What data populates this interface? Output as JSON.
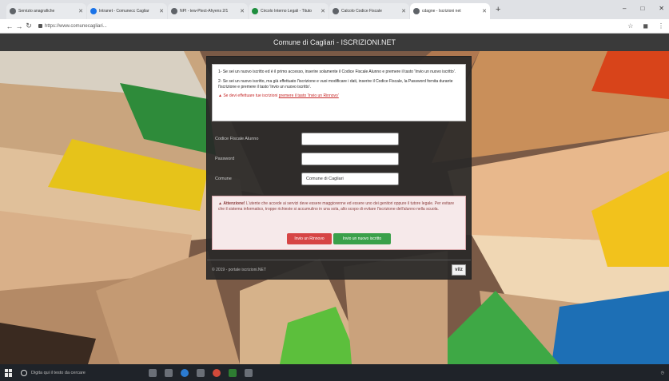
{
  "browser": {
    "tabs": [
      {
        "label": "Servizio anagrafiche",
        "favicon": "globe-icon"
      },
      {
        "label": "Intranet - Comunecc Cagliar",
        "favicon": "globe-icon"
      },
      {
        "label": "NPI - tew-Ptect-Ahyens 2/1",
        "favicon": "globe-icon"
      },
      {
        "label": "Circolo Interno Legali - Tituto",
        "favicon": "sheet-icon"
      },
      {
        "label": "Calcolo Codice Fiscale",
        "favicon": "globe-icon"
      },
      {
        "label": "cdagne - Iscrizioni net",
        "favicon": "globe-icon",
        "active": true
      }
    ],
    "new_tab": "+",
    "window_controls": [
      "–",
      "□",
      "✕"
    ],
    "url": "https://www.comunecagliari..."
  },
  "app": {
    "title": "Comune di Cagliari - ISCRIZIONI.NET"
  },
  "notice": {
    "line1": "1- Se sei un nuovo iscritto ed è il primo accesso, inserire solamente il Codice Fiscale Alunno e premere il tasto 'Invio un nuovo iscritto'.",
    "line2": "2- Se sei un nuovo iscritto, ma già effettuato l'iscrizione e vuoi modificare i dati, inserire il Codice Fiscale, la Password fornita durante l'iscrizione e premere il tasto 'Invio un nuovo iscritto'.",
    "line3_prefix": "Se devi effettuare tue iscrizioni",
    "line3_link": "premere il tasto 'Invio un Rinnovo'"
  },
  "form": {
    "fields": [
      {
        "label": "Codice Fiscale Alunno",
        "value": ""
      },
      {
        "label": "Password",
        "value": ""
      },
      {
        "label": "Comune",
        "value": "Comune di Cagliari"
      }
    ]
  },
  "alert": {
    "title": "Attenzione!",
    "text": "L'utente che accede ai servizi deve essere maggiorenne ed essere uno dei genitori oppure il tutore legale. Per evitare che il sistema informatico, troppe richieste si accumulino in una sola, allo scopo di evitare l'iscrizione dell'alunno nella scuola."
  },
  "buttons": {
    "renewal": "Invio un Rinnovo",
    "new_enrollment": "Invio un nuovo iscritto"
  },
  "footer": {
    "copyright": "© 2019 - portale iscrizioni.NET",
    "logo": "vilz"
  },
  "taskbar": {
    "search_placeholder": "Digita qui il testo da cercare"
  }
}
